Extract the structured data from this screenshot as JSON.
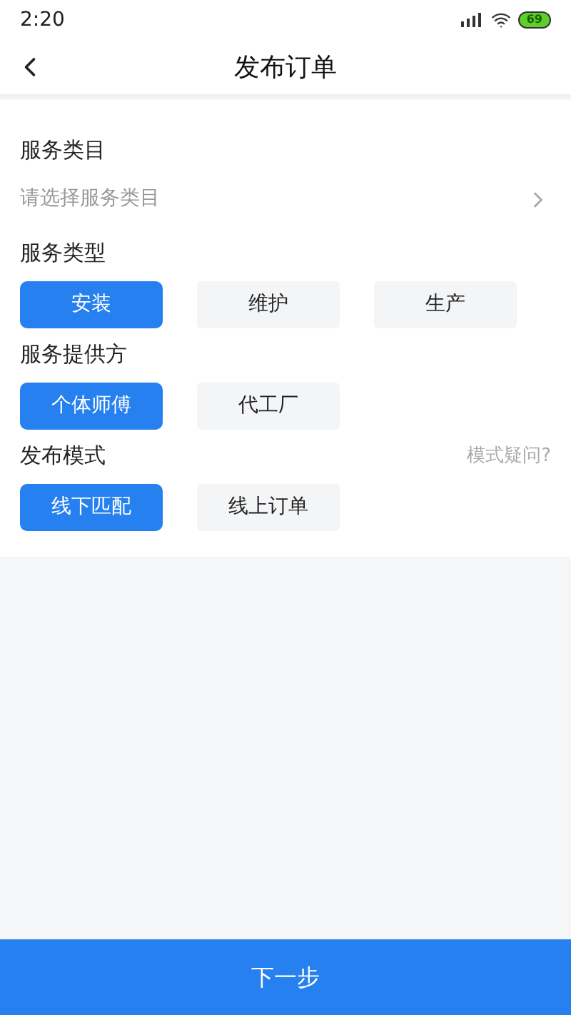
{
  "status_bar": {
    "time": "2:20",
    "battery": "69"
  },
  "header": {
    "title": "发布订单"
  },
  "category": {
    "label": "服务类目",
    "placeholder": "请选择服务类目"
  },
  "groups": [
    {
      "label": "服务类型",
      "options": [
        {
          "label": "安装",
          "selected": true
        },
        {
          "label": "维护",
          "selected": false
        },
        {
          "label": "生产",
          "selected": false
        }
      ]
    },
    {
      "label": "服务提供方",
      "options": [
        {
          "label": "个体师傅",
          "selected": true
        },
        {
          "label": "代工厂",
          "selected": false
        }
      ]
    },
    {
      "label": "发布模式",
      "help": "模式疑问?",
      "options": [
        {
          "label": "线下匹配",
          "selected": true
        },
        {
          "label": "线上订单",
          "selected": false
        }
      ]
    }
  ],
  "next_button": "下一步"
}
